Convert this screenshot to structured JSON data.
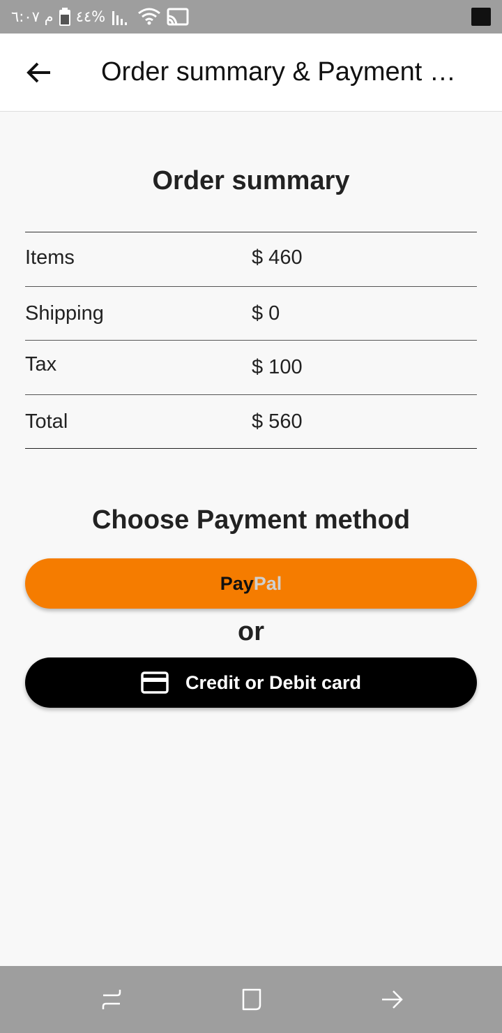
{
  "status_bar": {
    "time_text": "م ٦:٠٧",
    "battery_text": "%٤٤"
  },
  "app_bar": {
    "title": "Order summary & Payment …"
  },
  "order_summary": {
    "title": "Order summary",
    "rows": [
      {
        "label": "Items",
        "value": "$ 460"
      },
      {
        "label": "Shipping",
        "value": "$ 0"
      },
      {
        "label": "Tax",
        "value": "$ 100"
      },
      {
        "label": "Total",
        "value": "$ 560"
      }
    ]
  },
  "payment": {
    "title": "Choose Payment method",
    "paypal_part1": "Pay",
    "paypal_part2": "Pal",
    "or_text": "or",
    "card_label": "Credit or Debit card"
  },
  "colors": {
    "paypal_button": "#f57c00",
    "card_button": "#000000",
    "status_bar": "#9e9e9e",
    "nav_bar": "#9e9e9e"
  },
  "icons": {
    "back": "arrow-left-icon",
    "card": "credit-card-icon",
    "battery": "battery-icon",
    "signal": "signal-icon",
    "wifi": "wifi-icon",
    "cast": "cast-icon",
    "nav_recent": "recent-apps-icon",
    "nav_home": "home-icon",
    "nav_back": "back-nav-icon"
  }
}
